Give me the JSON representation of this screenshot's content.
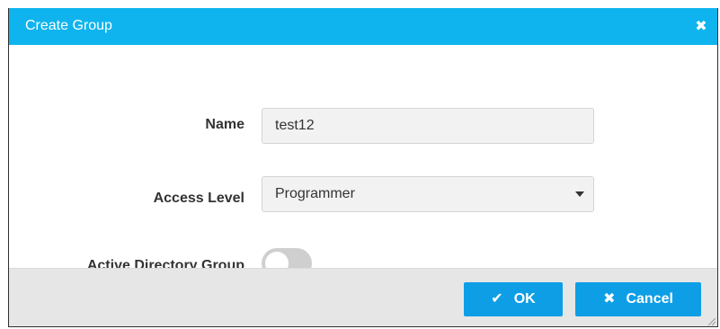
{
  "dialog": {
    "title": "Create Group",
    "close_icon": "close-icon"
  },
  "form": {
    "name_label": "Name",
    "name_value": "test12",
    "access_level_label": "Access Level",
    "access_level_value": "Programmer",
    "ad_group_label": "Active Directory Group",
    "ad_group_enabled": false
  },
  "footer": {
    "ok_label": "OK",
    "ok_icon": "check-icon",
    "cancel_label": "Cancel",
    "cancel_icon": "x-icon"
  },
  "colors": {
    "header": "#0fb4ee",
    "button": "#0e9ee6",
    "footer": "#e6e6e6"
  }
}
